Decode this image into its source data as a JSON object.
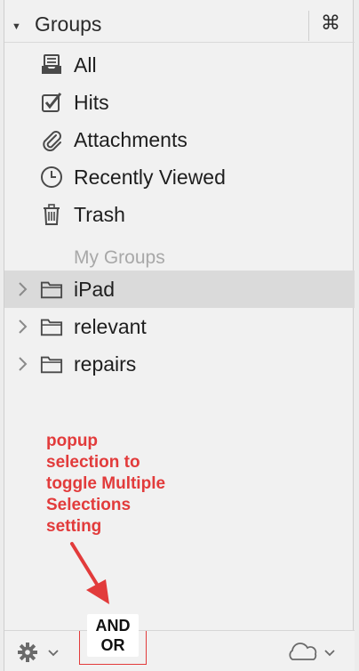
{
  "header": {
    "title": "Groups",
    "shortcut_glyph": "⌘"
  },
  "groups": {
    "items": [
      {
        "label": "All",
        "icon": "inbox-tray-icon"
      },
      {
        "label": "Hits",
        "icon": "checkbox-icon"
      },
      {
        "label": "Attachments",
        "icon": "paperclip-icon"
      },
      {
        "label": "Recently Viewed",
        "icon": "clock-icon"
      },
      {
        "label": "Trash",
        "icon": "trash-icon"
      }
    ]
  },
  "my_groups": {
    "heading": "My Groups",
    "items": [
      {
        "label": "iPad",
        "icon": "folder-icon",
        "selected": true
      },
      {
        "label": "relevant",
        "icon": "folder-icon",
        "selected": false
      },
      {
        "label": "repairs",
        "icon": "folder-icon",
        "selected": false
      }
    ]
  },
  "annotation": {
    "lines": [
      "popup",
      "selection to",
      "toggle Multiple",
      "Selections",
      "setting"
    ],
    "color": "#e23b3b"
  },
  "bottombar": {
    "and_label": "AND",
    "or_label": "OR"
  },
  "colors": {
    "accent_red": "#e23b3b",
    "selected_row": "#dadada",
    "panel_bg": "#f1f1f1"
  }
}
